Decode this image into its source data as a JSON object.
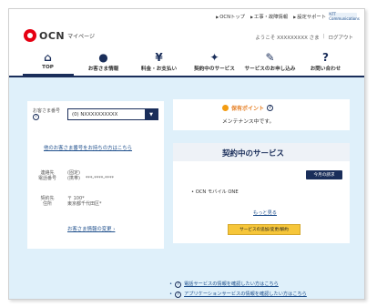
{
  "util": [
    "OCNトップ",
    "工事・故障情報",
    "設定サポート"
  ],
  "ntt": "NTT Communications",
  "logo": {
    "brand": "OCN",
    "sub": "マイページ"
  },
  "welcome": {
    "text": "ようこそ XXXXXXXXX さま",
    "logout": "ログアウト"
  },
  "nav": [
    {
      "label": "TOP",
      "icon": "⌂"
    },
    {
      "label": "お客さま情報",
      "icon": "●"
    },
    {
      "label": "料金・お支払い",
      "icon": "¥"
    },
    {
      "label": "契約中のサービス",
      "icon": "✦"
    },
    {
      "label": "サービスのお申し込み",
      "icon": "✎"
    },
    {
      "label": "お問い合わせ",
      "icon": "?"
    }
  ],
  "cust": {
    "label1": "お客さま番号",
    "value": "(0) NXXXXXXXXXX",
    "link": "他のお客さま番号をお持ちの方はこちら",
    "contact_k": "連絡先\n電話番号",
    "contact_sub": "(固定)\n(携帯)",
    "contact_v": "***-****-****",
    "addr_k": "契約先\n住所",
    "addr_v": "〒 100*\n東京都千代田区*",
    "change": "お客さま情報の変更"
  },
  "point": {
    "title": "保有ポイント",
    "msg": "メンテナンス中です。"
  },
  "svc": {
    "title": "契約中のサービス",
    "request": "今月の請求",
    "item": "OCN モバイル ONE",
    "more": "もっと見る",
    "btn": "サービスの追加/変更/解約"
  },
  "footer": [
    "電話サービスの情報を確認したい方はこちら",
    "アプリケーションサービスの情報を確認したい方はこちら"
  ]
}
